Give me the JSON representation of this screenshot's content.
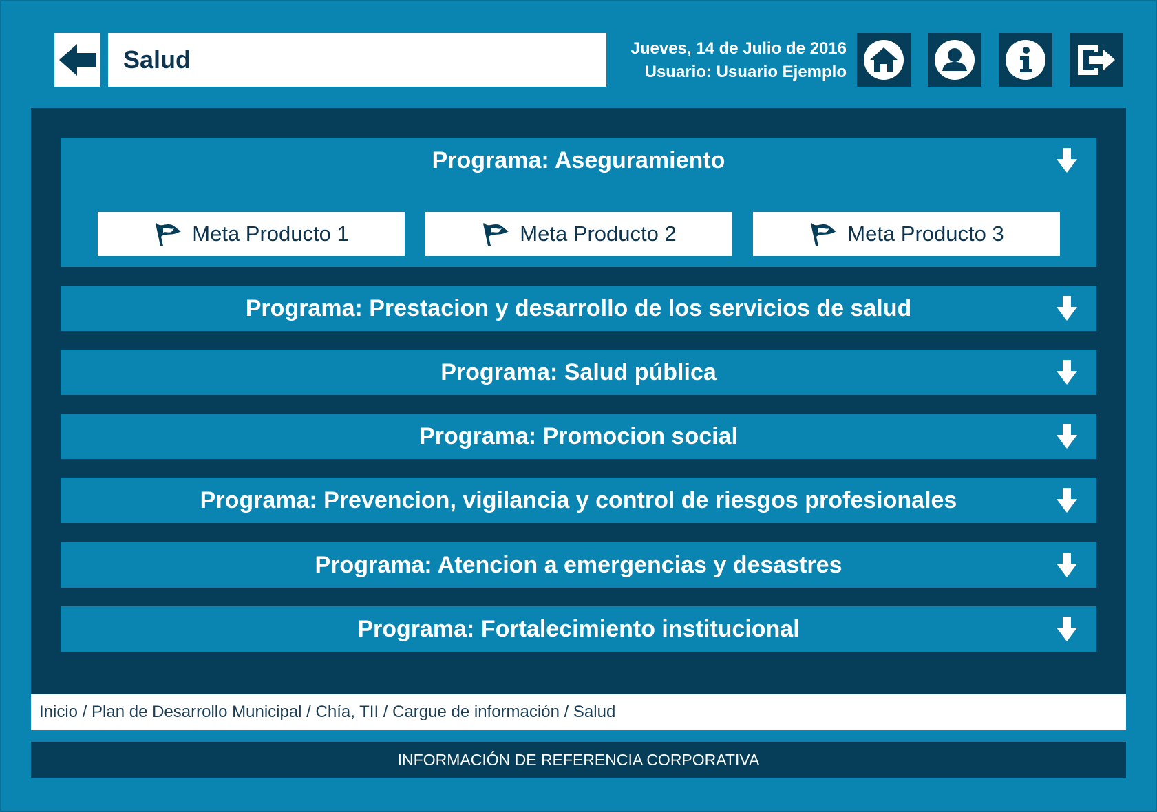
{
  "header": {
    "title": "Salud",
    "date": "Jueves, 14 de Julio de 2016",
    "user": "Usuario: Usuario Ejemplo",
    "buttons": {
      "home": "home-icon",
      "profile": "user-icon",
      "info": "info-icon",
      "logout": "logout-icon"
    }
  },
  "programs": [
    {
      "title": "Programa: Aseguramiento",
      "expanded": true,
      "metas": [
        "Meta Producto 1",
        "Meta Producto 2",
        "Meta Producto 3"
      ]
    },
    {
      "title": "Programa: Prestacion y desarrollo de los servicios de salud"
    },
    {
      "title": "Programa: Salud pública"
    },
    {
      "title": "Programa: Promocion social"
    },
    {
      "title": "Programa: Prevencion, vigilancia y control de riesgos profesionales"
    },
    {
      "title": "Programa: Atencion a emergencias y desastres"
    },
    {
      "title": "Programa: Fortalecimiento institucional"
    }
  ],
  "breadcrumb": "Inicio / Plan de Desarrollo Municipal / Chía, TII / Cargue de información / Salud",
  "footer": "INFORMACIÓN DE REFERENCIA CORPORATIVA",
  "colors": {
    "background": "#0a84b0",
    "panel": "#063e5a",
    "program_bar": "#0a84b0",
    "text_dark": "#0d3550"
  }
}
